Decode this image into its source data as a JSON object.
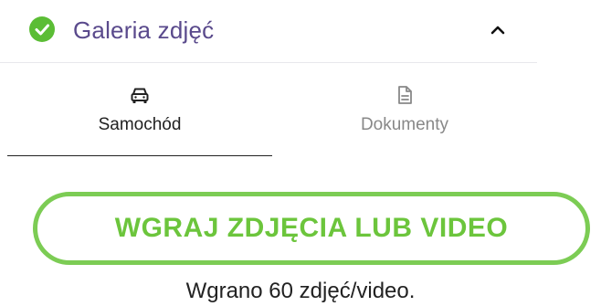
{
  "gallery_section": {
    "title": "Galeria zdjęć",
    "status_icon": "check-circle-icon",
    "collapse_icon": "chevron-up-icon",
    "expanded": true
  },
  "tabs": [
    {
      "label": "Samochód",
      "icon": "car-icon",
      "active": true
    },
    {
      "label": "Dokumenty",
      "icon": "document-icon",
      "active": false
    }
  ],
  "upload": {
    "button_label": "WGRAJ ZDJĘCIA LUB VIDEO",
    "status_text": "Wgrano 60 zdjęć/video."
  },
  "colors": {
    "accent_green": "#6cc53c",
    "button_border": "#7ccc54",
    "title_purple": "#5a4a8c",
    "inactive_tab": "#888888",
    "text_dark": "#222222"
  }
}
